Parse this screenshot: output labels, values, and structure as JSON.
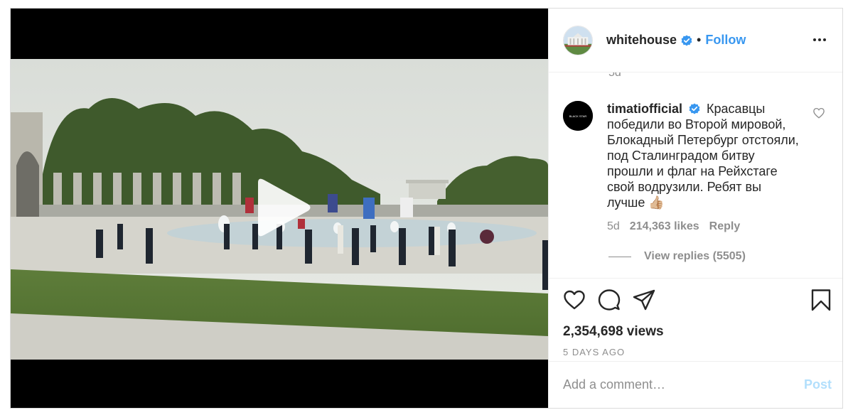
{
  "post": {
    "author": "whitehouse",
    "author_verified": true,
    "separator": "•",
    "follow_label": "Follow",
    "more_icon": "more-options-icon"
  },
  "video": {
    "play_icon": "play-icon"
  },
  "comments": {
    "previous_time": "5d",
    "items": [
      {
        "user": "timatiofficial",
        "verified": true,
        "text": "Красавцы победили во Второй мировой, Блокадный Петербург отстояли, под Сталинградом битву прошли и флаг на Рейхстаге свой водрузили. Ребят вы лучше 👍🏼",
        "time": "5d",
        "likes": "214,363 likes",
        "reply_label": "Reply",
        "view_replies": "View replies (5505)"
      }
    ]
  },
  "actions": {
    "like_icon": "heart-icon",
    "comment_icon": "comment-icon",
    "share_icon": "share-icon",
    "save_icon": "bookmark-icon"
  },
  "stats": {
    "views": "2,354,698 views",
    "posted": "5 DAYS AGO"
  },
  "composer": {
    "placeholder": "Add a comment…",
    "post_label": "Post"
  },
  "colors": {
    "link_blue": "#3897f0",
    "post_disabled": "#b2dffc",
    "muted": "#8e8e8e",
    "verified": "#3897f0"
  }
}
